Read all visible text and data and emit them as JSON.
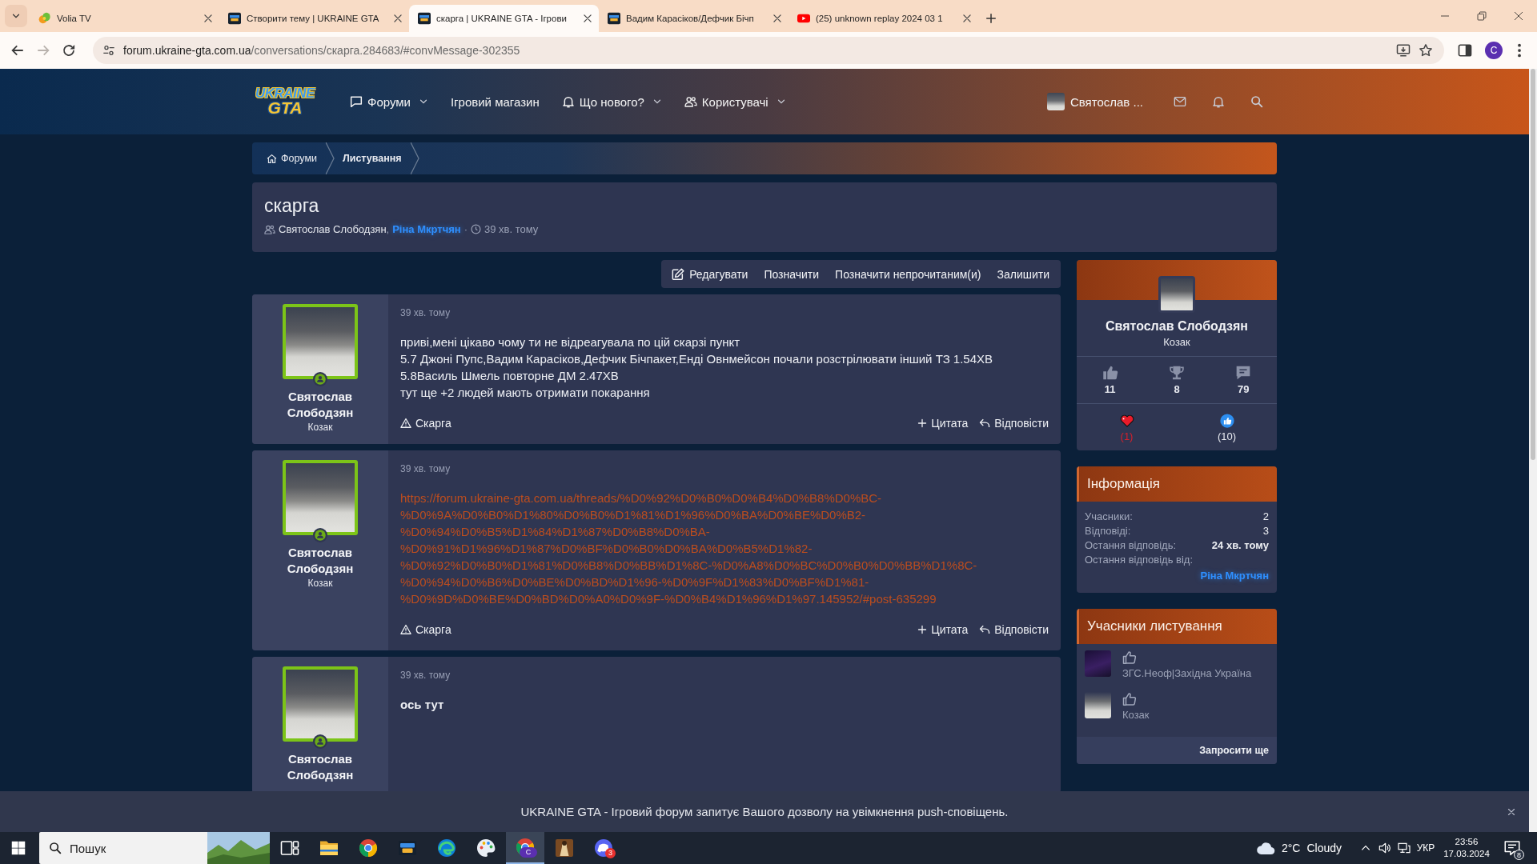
{
  "browser": {
    "tabs": [
      {
        "title": "Volia TV",
        "kind": "tv",
        "selected": false
      },
      {
        "title": "Створити тему | UKRAINE GTA",
        "kind": "forum",
        "selected": false
      },
      {
        "title": "скарга | UKRAINE GTA - Ігрови",
        "kind": "forum",
        "selected": true
      },
      {
        "title": "Вадим Карасіков/Дефчик Бічп",
        "kind": "forum",
        "selected": false
      },
      {
        "title": "(25) unknown replay 2024 03 1",
        "kind": "video",
        "selected": false
      }
    ],
    "nav_buttons": [
      {
        "kind": "back",
        "disabled": false
      },
      {
        "kind": "forward",
        "disabled": true
      },
      {
        "kind": "reload",
        "disabled": false
      }
    ],
    "address": {
      "host": "forum.ukraine-gta.com.ua",
      "path": "/conversations/скарга.284683/#convMessage-302355"
    },
    "profile": "C"
  },
  "header": {
    "logo": {
      "top": "UKRAINE",
      "bottom": "GTA"
    },
    "nav": [
      {
        "label": "Форуми",
        "kind": "forums",
        "dropdown": true
      },
      {
        "label": "Ігровий магазин",
        "kind": "store",
        "dropdown": false
      },
      {
        "label": "Що нового?",
        "kind": "news",
        "dropdown": true
      },
      {
        "label": "Користувачі",
        "kind": "members",
        "dropdown": true
      }
    ],
    "user": "Святослав ..."
  },
  "breadcrumb": [
    {
      "label": "Форуми",
      "kind": "home",
      "current": false
    },
    {
      "label": "Листування",
      "kind": "page",
      "current": true
    }
  ],
  "conversation": {
    "title": "скарга",
    "participants": [
      {
        "name": "Святослав Слободзян",
        "highlight": false
      },
      {
        "name": "Ріна Мкртчян",
        "highlight": true
      }
    ],
    "separator": ",",
    "dot": "·",
    "time": "39 хв. тому"
  },
  "actions": [
    {
      "label": "Редагувати",
      "kind": "edit"
    },
    {
      "label": "Позначити",
      "kind": "plain"
    },
    {
      "label": "Позначити непрочитаним(и)",
      "kind": "plain"
    },
    {
      "label": "Залишити",
      "kind": "plain"
    }
  ],
  "posts": [
    {
      "author": "Святослав Слободзян",
      "rank": "Козак",
      "online": true,
      "time": "39 хв. тому",
      "body": {
        "kind": "text",
        "lines": [
          "приві,мені цікаво чому ти не відреагувала по цій скарзі пункт",
          "5.7 Джоні Пупс,Вадим Карасіков,Дефчик Бічпакет,Енді Овнмейсон почали розстрілювати інший ТЗ 1.54ХВ",
          "5.8Василь Шмель повторне ДМ 2.47ХВ",
          "тут ще +2 людей мають отримати покарання"
        ]
      },
      "footer": {
        "report": "Скарга",
        "quote": "Цитата",
        "reply": "Відповісти"
      }
    },
    {
      "author": "Святослав Слободзян",
      "rank": "Козак",
      "online": true,
      "time": "39 хв. тому",
      "body": {
        "kind": "link",
        "url": "https://forum.ukraine-gta.com.ua/threads/%D0%92%D0%B0%D0%B4%D0%B8%D0%BC-%D0%9A%D0%B0%D1%80%D0%B0%D1%81%D1%96%D0%BA%D0%BE%D0%B2-%D0%94%D0%B5%D1%84%D1%87%D0%B8%D0%BA-%D0%91%D1%96%D1%87%D0%BF%D0%B0%D0%BA%D0%B5%D1%82-%D0%92%D0%B0%D1%81%D0%B8%D0%BB%D1%8C-%D0%A8%D0%BC%D0%B0%D0%BB%D1%8C-%D0%94%D0%B6%D0%BE%D0%BD%D1%96-%D0%9F%D1%83%D0%BF%D1%81-%D0%9D%D0%BE%D0%BD%D0%A0%D0%9F-%D0%B4%D1%96%D1%97.145952/#post-635299"
      },
      "footer": {
        "report": "Скарга",
        "quote": "Цитата",
        "reply": "Відповісти"
      }
    },
    {
      "author": "Святослав Слободзян",
      "online": true,
      "time": "39 хв. тому",
      "body": {
        "kind": "bold",
        "lines": [
          "ось тут"
        ]
      }
    }
  ],
  "sidebar": {
    "profile": {
      "name": "Святослав Слободзян",
      "rank": "Козак",
      "stats": [
        {
          "kind": "likes",
          "value": "11"
        },
        {
          "kind": "trophies",
          "value": "8"
        },
        {
          "kind": "messages",
          "value": "79"
        }
      ],
      "reactions": [
        {
          "kind": "love",
          "count": "(1)"
        },
        {
          "kind": "like",
          "count": "(10)"
        }
      ]
    },
    "info": {
      "title": "Інформація",
      "rows": [
        {
          "label": "Учасники:",
          "value": "2",
          "kind": "plain"
        },
        {
          "label": "Відповіді:",
          "value": "3",
          "kind": "plain"
        },
        {
          "label": "Остання відповідь:",
          "value": "24 хв. тому",
          "kind": "strong"
        },
        {
          "label": "Остання відповідь від:",
          "value": "Ріна Мкртчян",
          "kind": "user"
        }
      ]
    },
    "members": {
      "title": "Учасники листування",
      "items": [
        {
          "title": "ЗГС.Неоф|Західна Україна"
        },
        {
          "title": "Козак"
        }
      ],
      "invite": "Запросити ще"
    }
  },
  "notice": {
    "text": "UKRAINE GTA - Ігровий форум запитує Вашого дозволу на увімкнення push-сповіщень."
  },
  "taskbar": {
    "search": {
      "placeholder": "Пошук"
    },
    "apps": [
      {
        "kind": "taskview",
        "selected": false
      },
      {
        "kind": "folder",
        "selected": false
      },
      {
        "kind": "chrome",
        "selected": false
      },
      {
        "kind": "gta",
        "selected": false
      },
      {
        "kind": "edge",
        "selected": false
      },
      {
        "kind": "paint",
        "selected": false
      },
      {
        "kind": "chrome",
        "selected": true,
        "badge": {
          "text": "C",
          "kind": "profile"
        }
      },
      {
        "kind": "game",
        "selected": false
      },
      {
        "kind": "discord",
        "selected": false,
        "badge": {
          "text": "3",
          "kind": "count"
        }
      }
    ],
    "weather": {
      "temp": "2°C",
      "condition": "Cloudy"
    },
    "language": "УКР",
    "time": "23:56",
    "date": "17.03.2024",
    "notifications": "8"
  }
}
